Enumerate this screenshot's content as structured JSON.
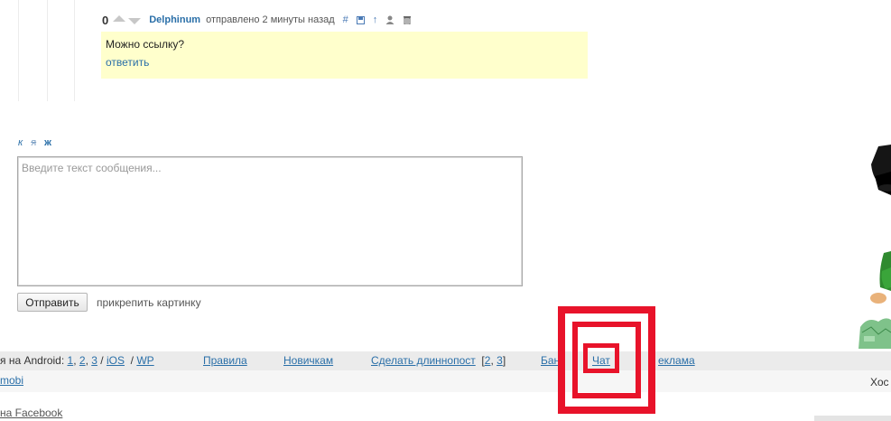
{
  "comment": {
    "score": "0",
    "author": "Delphinum",
    "posted": "отправлено 2 минуты назад",
    "text": "Можно ссылку?",
    "reply_label": "ответить",
    "tools": [
      "hash-icon",
      "save-icon",
      "arrow-up-icon",
      "user-icon",
      "trash-icon"
    ],
    "hash_label": "#",
    "up_label": "↑"
  },
  "editor": {
    "format_italic": "к",
    "format_strike": "я",
    "format_bold": "ж",
    "placeholder": "Введите текст сообщения...",
    "send_label": "Отправить",
    "attach_label": "прикрепить картинку"
  },
  "footer": {
    "android_prefix": "я на Android:",
    "android_links": [
      "1",
      "2",
      "3"
    ],
    "ios": "iOS",
    "wp": "WP",
    "sep": "/",
    "rules": "Правила",
    "newbies": "Новичкам",
    "longpost": "Сделать длиннопост",
    "longpost_links": [
      "2",
      "3"
    ],
    "ban": "Бан",
    "chat": "Чат",
    "ads": "еклама",
    "mobi": "mobi",
    "host": "Хос",
    "facebook": "на Facebook"
  },
  "colors": {
    "link": "#2a6fa8",
    "highlight_ring": "#e8132a",
    "comment_bg": "#ffffcc"
  }
}
